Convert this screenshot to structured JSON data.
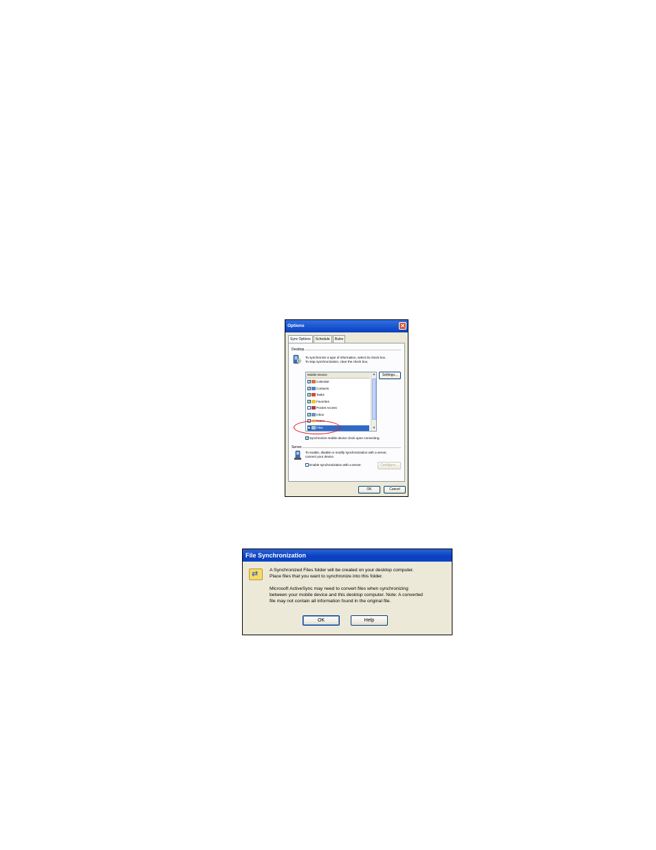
{
  "options_dialog": {
    "title": "Options",
    "close_label": "✕",
    "tabs": [
      "Sync Options",
      "Schedule",
      "Rules"
    ],
    "desktop_section": {
      "label": "Desktop",
      "info_line1": "To synchronize a type of information, select its check box.",
      "info_line2": "To stop synchronization, clear the check box."
    },
    "list": {
      "header": "Mobile Device",
      "items": [
        {
          "label": "Calendar",
          "checked": true
        },
        {
          "label": "Contacts",
          "checked": true
        },
        {
          "label": "Tasks",
          "checked": true
        },
        {
          "label": "Favorites",
          "checked": true
        },
        {
          "label": "Pocket Access",
          "checked": false
        },
        {
          "label": "Inbox",
          "checked": true
        },
        {
          "label": "Notes",
          "checked": false
        },
        {
          "label": "Files",
          "checked": true,
          "selected": true
        }
      ]
    },
    "settings_button": "Settings...",
    "sync_clock_label": "Synchronize mobile device clock upon connecting.",
    "server_section": {
      "label": "Server",
      "info_line1": "To enable, disable or modify synchronization with a server,",
      "info_line2": "connect your device.",
      "enable_label": "Enable synchronization with a server.",
      "configure_button": "Configure..."
    },
    "ok_button": "OK",
    "cancel_button": "Cancel"
  },
  "file_sync_dialog": {
    "title": "File Synchronization",
    "para1_line1": "A Synchronized Files folder will be created on your desktop computer.",
    "para1_line2": "Place files that you want to synchronize into this folder.",
    "para2_line1": "Microsoft ActiveSync may need to convert files when synchronizing",
    "para2_line2": "between your mobile device and this desktop computer.  Note: A converted",
    "para2_line3": "file may not contain all information found in the original file.",
    "ok_button": "OK",
    "help_button": "Help"
  },
  "colors": {
    "title_bar": "#0a3fbf",
    "dialog_bg": "#ece9d8",
    "selection": "#316ac5",
    "annotation_oval": "#e2141a"
  }
}
